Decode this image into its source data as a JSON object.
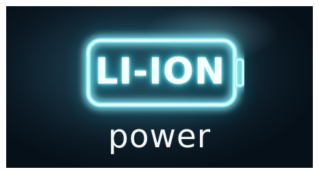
{
  "logo": {
    "main_text": "LI-ION",
    "sub_text": "power"
  },
  "colors": {
    "background_dark": "#0b1a25",
    "background_light": "#2a4a5a",
    "glow": "#48d8e8",
    "text": "#f6ffff"
  }
}
